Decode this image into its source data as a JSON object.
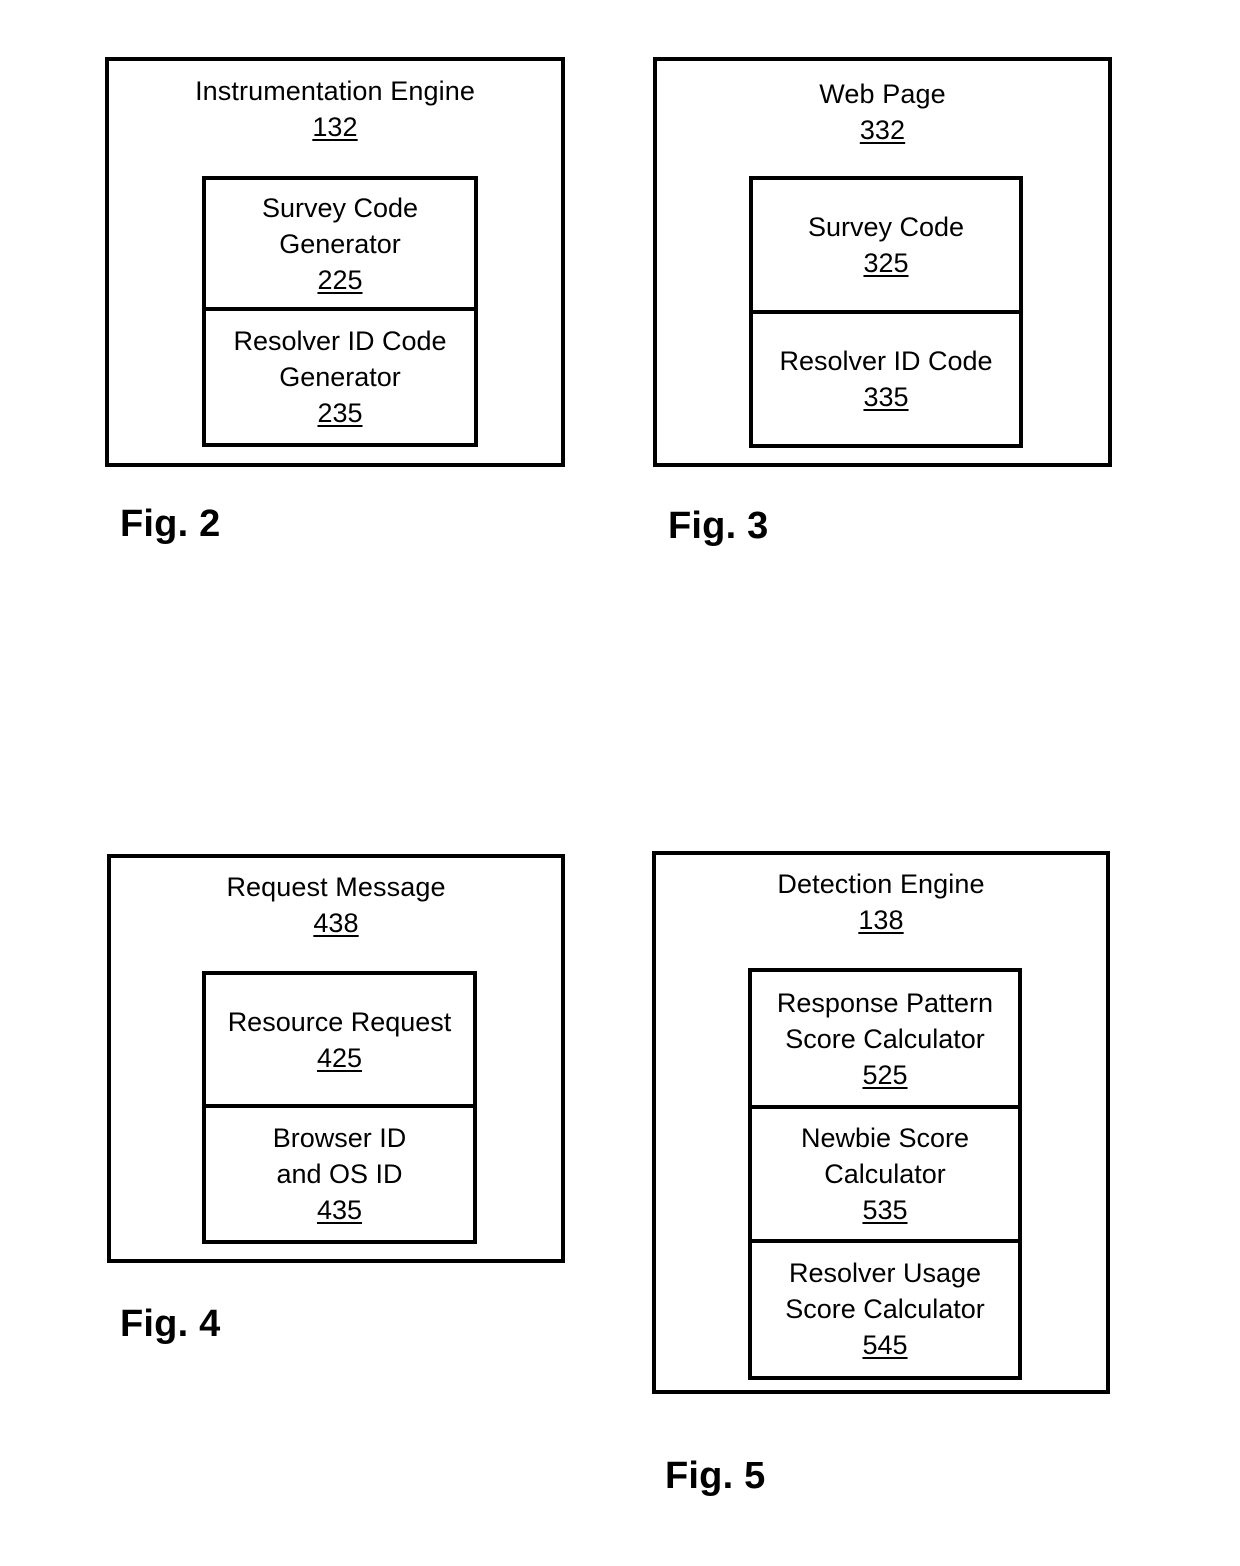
{
  "figures": [
    {
      "caption": "Fig. 2",
      "title": "Instrumentation Engine",
      "ref": "132",
      "cells": [
        {
          "line1": "Survey Code",
          "line2": "Generator",
          "ref": "225"
        },
        {
          "line1": "Resolver ID Code",
          "line2": "Generator",
          "ref": "235"
        }
      ]
    },
    {
      "caption": "Fig. 3",
      "title": "Web Page",
      "ref": "332",
      "cells": [
        {
          "line1": "Survey Code",
          "line2": "",
          "ref": "325"
        },
        {
          "line1": "Resolver ID Code",
          "line2": "",
          "ref": "335"
        }
      ]
    },
    {
      "caption": "Fig. 4",
      "title": "Request Message",
      "ref": "438",
      "cells": [
        {
          "line1": "Resource Request",
          "line2": "",
          "ref": "425"
        },
        {
          "line1": "Browser ID",
          "line2": "and OS ID",
          "ref": "435"
        }
      ]
    },
    {
      "caption": "Fig. 5",
      "title": "Detection Engine",
      "ref": "138",
      "cells": [
        {
          "line1": "Response Pattern",
          "line2": "Score Calculator",
          "ref": "525"
        },
        {
          "line1": "Newbie Score",
          "line2": "Calculator",
          "ref": "535"
        },
        {
          "line1": "Resolver Usage",
          "line2": "Score Calculator",
          "ref": "545"
        }
      ]
    }
  ]
}
